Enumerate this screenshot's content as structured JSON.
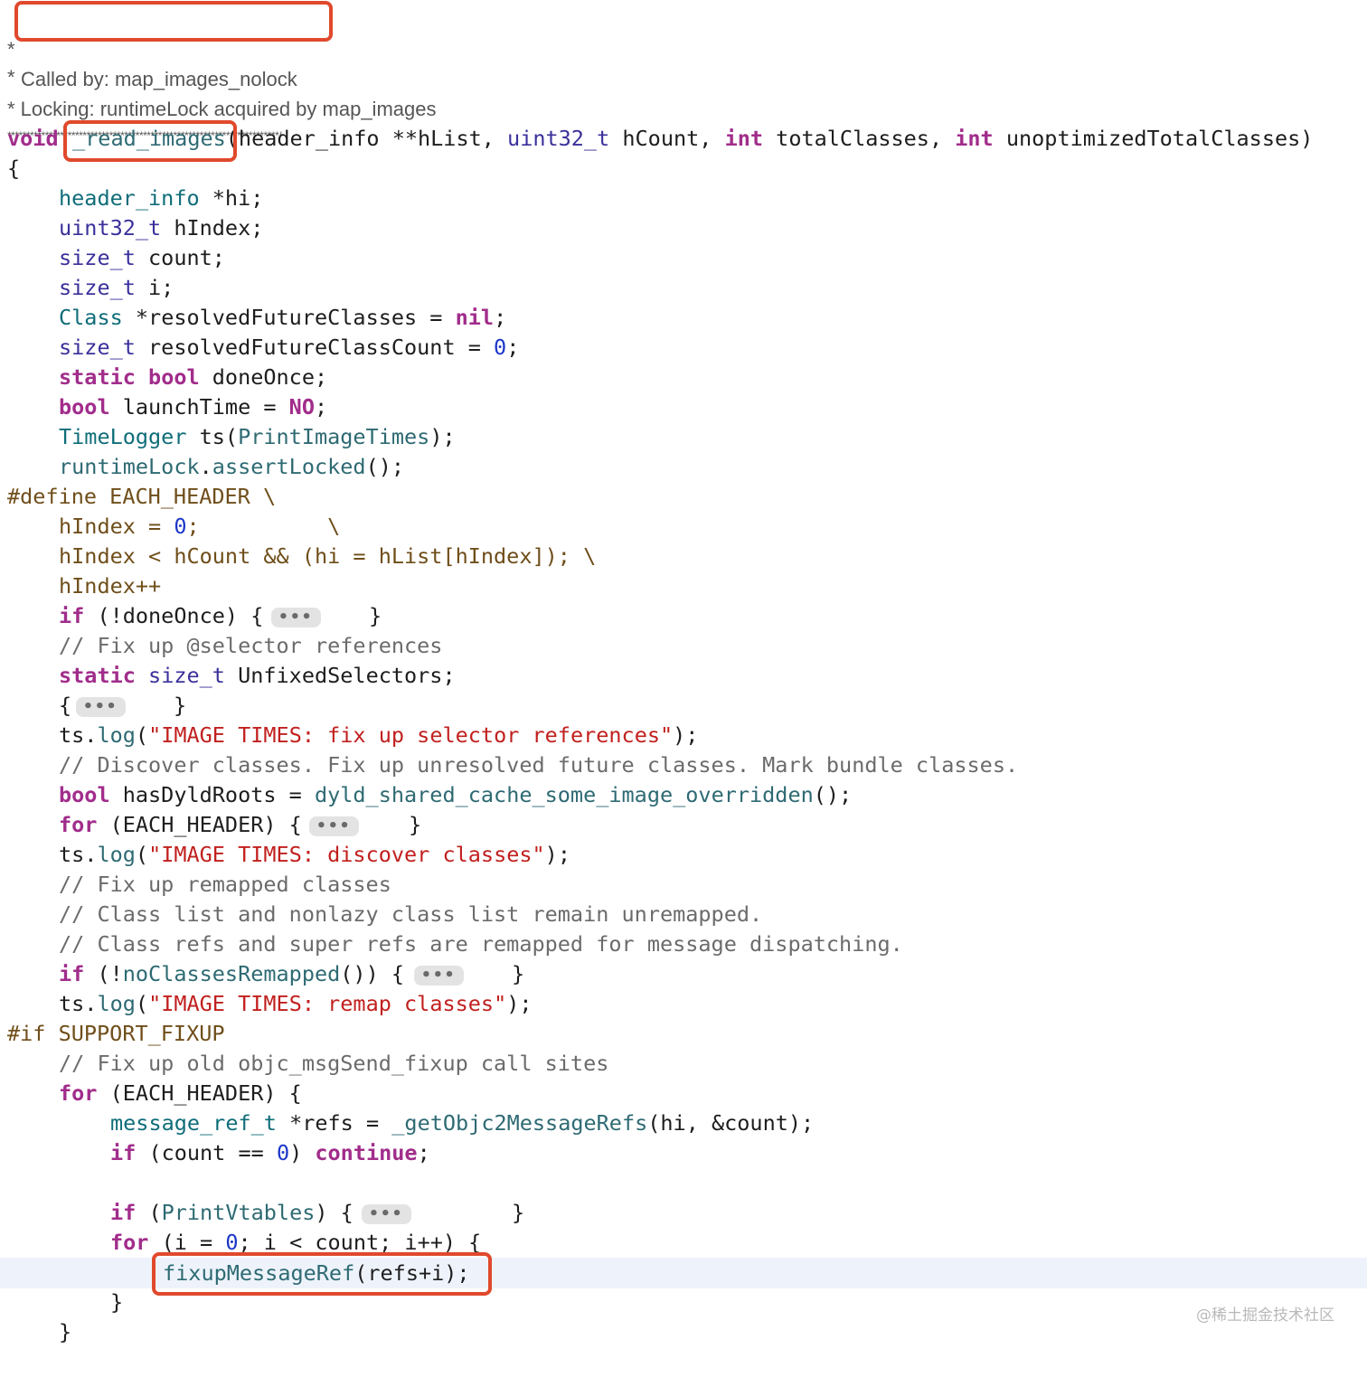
{
  "header": {
    "star": "*",
    "called_by": "Called by: map_images_nolock",
    "star2": "*",
    "locking": "* Locking: runtimeLock acquired by map_images",
    "stars_line": "************************************************************************/"
  },
  "code": {
    "sig_void": "void",
    "sig_fn": "_read_images",
    "sig_p1": "(header_info **hList, ",
    "sig_t2": "uint32_t",
    "sig_p2": " hCount, ",
    "sig_t3": "int",
    "sig_p3": " totalClasses, ",
    "sig_t4": "int",
    "sig_p4": " unoptimizedTotalClasses)",
    "open_brace": "{",
    "l_hi_t": "header_info",
    "l_hi": " *hi;",
    "l_hidx_t": "uint32_t",
    "l_hidx": " hIndex;",
    "l_cnt_t": "size_t",
    "l_cnt": " count;",
    "l_i_t": "size_t",
    "l_i": " i;",
    "l_cls_t": "Class",
    "l_cls": " *resolvedFutureClasses = ",
    "l_cls_nil": "nil",
    "l_rfc_t": "size_t",
    "l_rfc": " resolvedFutureClassCount = ",
    "l_rfc_n": "0",
    "l_static": "static",
    "l_bool": "bool",
    "l_done": " doneOnce;",
    "l_bool2": "bool",
    "l_launch": " launchTime = ",
    "l_no": "NO",
    "l_tl_t": "TimeLogger",
    "l_tl": " ts(",
    "l_tl_arg": "PrintImageTimes",
    "l_tl_end": ");",
    "l_rl": "runtimeLock",
    "l_rl_dot": ".",
    "l_rl_fn": "assertLocked",
    "l_rl_end": "();",
    "d_define": "#define EACH_HEADER \\",
    "d_l1a": "hIndex = ",
    "d_l1n": "0",
    "d_l1b": ";          \\",
    "d_l2": "hIndex < hCount && (hi = hList[hIndex]); \\",
    "d_l3": "hIndex++",
    "if1_kw": "if",
    "if1": " (!doneOnce) {",
    "fold": "•••",
    "close": "}",
    "cm1": "// Fix up @selector references",
    "st_kw": "static",
    "st_t": "size_t",
    "st": " UnfixedSelectors;",
    "br_open": "{",
    "ts1a": "ts.",
    "ts_log": "log",
    "ts1s": "\"IMAGE TIMES: fix up selector references\"",
    "cm2": "// Discover classes. Fix up unresolved future classes. Mark bundle classes.",
    "hd_kw": "bool",
    "hd": " hasDyldRoots = ",
    "hd_fn": "dyld_shared_cache_some_image_overridden",
    "hd_end": "();",
    "for1_kw": "for",
    "for1": " (EACH_HEADER) {",
    "ts2s": "\"IMAGE TIMES: discover classes\"",
    "cm3": "// Fix up remapped classes",
    "cm4": "// Class list and nonlazy class list remain unremapped.",
    "cm5": "// Class refs and super refs are remapped for message dispatching.",
    "if2_kw": "if",
    "if2a": " (!",
    "if2_fn": "noClassesRemapped",
    "if2b": "()) {",
    "ts3s": "\"IMAGE TIMES: remap classes\"",
    "pp_if": "#if SUPPORT_FIXUP",
    "cm6": "// Fix up old objc_msgSend_fixup call sites",
    "for2_kw": "for",
    "for2": " (EACH_HEADER) {",
    "mr_t": "message_ref_t",
    "mr": " *refs = ",
    "mr_fn": "_getObjc2MessageRefs",
    "mr_end": "(hi, &count);",
    "if3_kw": "if",
    "if3a": " (count == ",
    "if3n": "0",
    "if3b": ") ",
    "if3_cont": "continue",
    "semi": ";",
    "if4_kw": "if",
    "if4a": " (",
    "if4_arg": "PrintVtables",
    "if4b": ") {",
    "for3_kw": "for",
    "for3a": " (i = ",
    "for3n": "0",
    "for3b": "; i < count; i++) {",
    "fx_fn": "fixupMessageRef",
    "fx_end": "(refs+i);",
    "paren_open": "(",
    "paren_close": ");"
  },
  "watermark": "@稀土掘金技术社区"
}
